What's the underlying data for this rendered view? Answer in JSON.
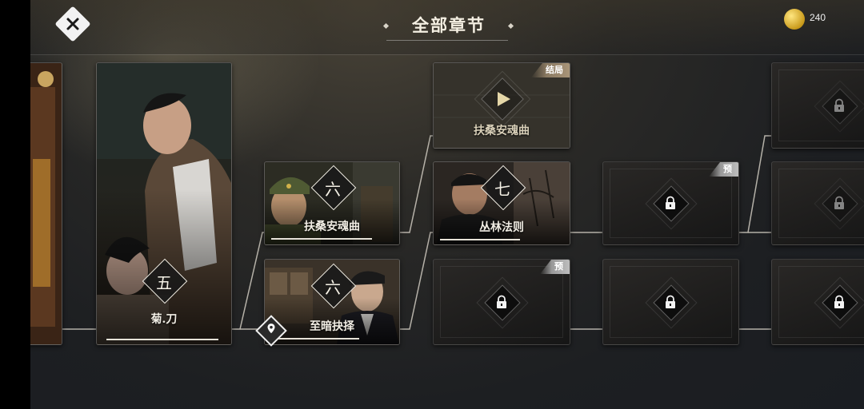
{
  "header": {
    "title": "全部章节",
    "close_icon": "close-icon",
    "coins": {
      "icon": "gold-coin-icon",
      "count": "240"
    }
  },
  "chapters": [
    {
      "id": "ch5",
      "num": "五",
      "name": "菊.刀",
      "state": "cleared"
    },
    {
      "id": "ch6a",
      "num": "六",
      "name": "扶桑安魂曲",
      "state": "cleared"
    },
    {
      "id": "ch6b",
      "num": "六",
      "name": "至暗抉择",
      "state": "current"
    },
    {
      "id": "ch7",
      "num": "七",
      "name": "丛林法则",
      "state": "cleared"
    },
    {
      "id": "end",
      "num": "",
      "name": "扶桑安魂曲",
      "state": "ending",
      "tag": "结局"
    }
  ],
  "locked": {
    "preview_tag": "预",
    "icon": "lock-icon"
  },
  "colors": {
    "accent": "#e6e2d8",
    "coin": "#d4a62a",
    "tag_end": "#8b7a62",
    "tag_preview": "#a8a8a8"
  }
}
